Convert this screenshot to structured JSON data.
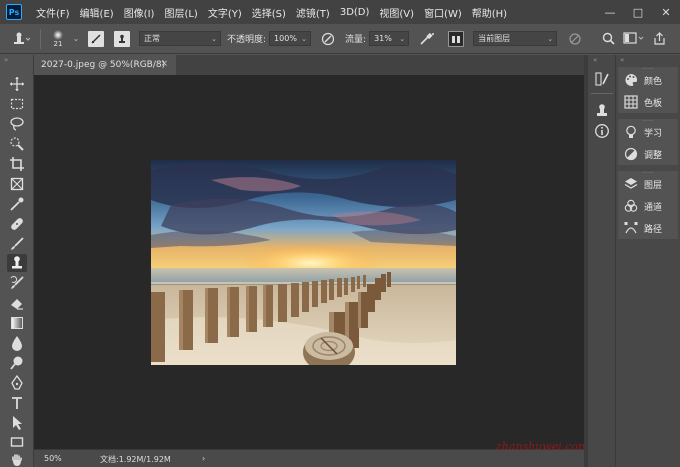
{
  "app": {
    "logo_text": "Ps"
  },
  "menubar": {
    "items": [
      "文件(F)",
      "编辑(E)",
      "图像(I)",
      "图层(L)",
      "文字(Y)",
      "选择(S)",
      "滤镜(T)",
      "3D(D)",
      "视图(V)",
      "窗口(W)",
      "帮助(H)"
    ],
    "window_controls": {
      "minimize": "—",
      "maximize": "□",
      "close": "✕"
    }
  },
  "options_bar": {
    "brush_size": "21",
    "mode_value": "正常",
    "opacity_label": "不透明度:",
    "opacity_value": "100%",
    "flow_label": "流量:",
    "flow_value": "31%",
    "sample_value": "当前图层"
  },
  "document": {
    "tab_title": "2027-0.jpeg @ 50%(RGB/8)",
    "tab_close": "×",
    "zoom": "50%",
    "doc_info": "文档:1.92M/1.92M",
    "status_arrow": "›"
  },
  "watermark": "zhanshuwei.com",
  "panels": {
    "group1": [
      {
        "label": "颜色",
        "icon": "palette-icon"
      },
      {
        "label": "色板",
        "icon": "swatches-grid-icon"
      }
    ],
    "group2": [
      {
        "label": "学习",
        "icon": "lightbulb-icon"
      },
      {
        "label": "调整",
        "icon": "adjustment-circle-icon"
      }
    ],
    "group3": [
      {
        "label": "图层",
        "icon": "layers-stack-icon"
      },
      {
        "label": "通道",
        "icon": "channels-icon"
      },
      {
        "label": "路径",
        "icon": "pen-path-icon"
      }
    ]
  },
  "colors": {
    "background": "#535353",
    "canvas": "#282828",
    "menubar": "#424242",
    "accent": "#31a8ff"
  }
}
